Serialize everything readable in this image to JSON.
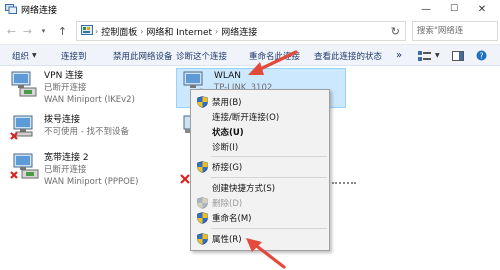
{
  "window": {
    "title": "网络连接",
    "minimize": "—",
    "maximize": "☐",
    "close": "✕"
  },
  "address": {
    "crumbs": [
      "控制面板",
      "网络和 Internet",
      "网络连接"
    ],
    "search_placeholder": "搜索\"网络连"
  },
  "toolbar": {
    "organize": "组织",
    "connect_to": "连接到",
    "disable_device": "禁用此网络设备",
    "diagnose": "诊断这个连接",
    "rename": "重命名此连接",
    "view_status": "查看此连接的状态",
    "more": "»"
  },
  "connections": [
    {
      "name": "VPN 连接",
      "status": "已断开连接",
      "device": "WAN Miniport (IKEv2)"
    },
    {
      "name": "拨号连接",
      "status": "不可使用 - 找不到设备",
      "device": ""
    },
    {
      "name": "宽带连接 2",
      "status": "已断开连接",
      "device": "WAN Miniport (PPPOE)"
    },
    {
      "name": "WLAN",
      "status": "TP-LINK_3102",
      "device": ""
    }
  ],
  "context_menu": {
    "disable": "禁用(B)",
    "connect_disconnect": "连接/断开连接(O)",
    "status": "状态(U)",
    "diagnose": "诊断(I)",
    "bridge": "桥接(G)",
    "create_shortcut": "创建快捷方式(S)",
    "delete": "删除(D)",
    "rename": "重命名(M)",
    "properties": "属性(R)"
  },
  "colors": {
    "accent": "#1e3a6e",
    "selection": "#cce8ff",
    "arrow": "#e24a3b",
    "menu_bg": "#f2f2f2"
  }
}
